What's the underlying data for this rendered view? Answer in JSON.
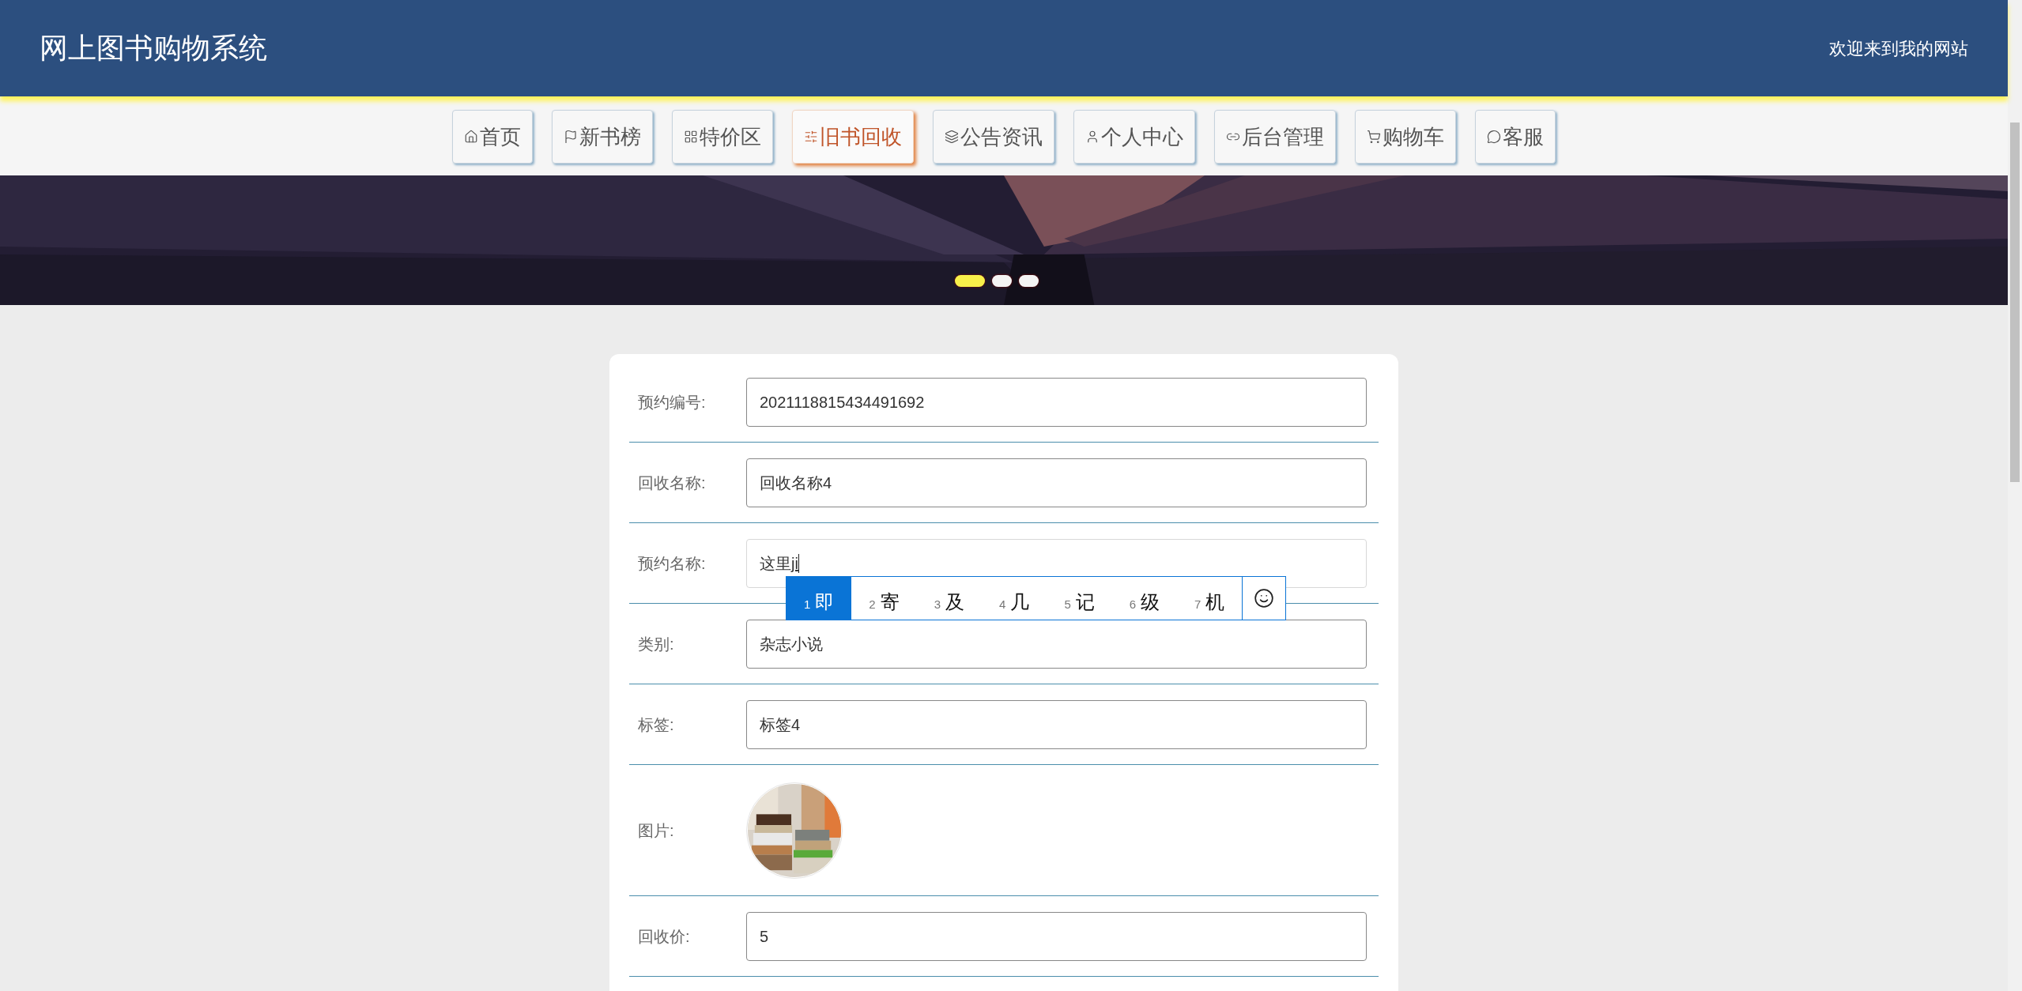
{
  "header": {
    "title": "网上图书购物系统",
    "welcome": "欢迎来到我的网站"
  },
  "nav": [
    {
      "label": "首页",
      "selected": false
    },
    {
      "label": "新书榜",
      "selected": false
    },
    {
      "label": "特价区",
      "selected": false
    },
    {
      "label": "旧书回收",
      "selected": true
    },
    {
      "label": "公告资讯",
      "selected": false
    },
    {
      "label": "个人中心",
      "selected": false
    },
    {
      "label": "后台管理",
      "selected": false
    },
    {
      "label": "购物车",
      "selected": false
    },
    {
      "label": "客服",
      "selected": false
    }
  ],
  "banner": {
    "kind": "picture",
    "dots": [
      {
        "selected": true
      },
      {
        "selected": false
      },
      {
        "selected": false
      }
    ]
  },
  "form": [
    {
      "kind": "input",
      "label": "预约编号:",
      "value": "2021118815434491692",
      "focused": false
    },
    {
      "kind": "input",
      "label": "回收名称:",
      "value": "回收名称4",
      "focused": false
    },
    {
      "kind": "input",
      "label": "预约名称:",
      "value": "这里",
      "composition": "ji",
      "focused": true
    },
    {
      "kind": "input",
      "label": "类别:",
      "value": "杂志小说",
      "focused": false
    },
    {
      "kind": "input",
      "label": "标签:",
      "value": "标签4",
      "focused": false
    },
    {
      "label": "图片:"
    },
    {
      "kind": "input",
      "label": "回收价:",
      "value": "5",
      "focused": false
    }
  ],
  "ime": {
    "candidates": [
      {
        "number": "1",
        "text": "即",
        "selected": true
      },
      {
        "number": "2",
        "text": "寄",
        "selected": false
      },
      {
        "number": "3",
        "text": "及",
        "selected": false
      },
      {
        "number": "4",
        "text": "几",
        "selected": false
      },
      {
        "number": "5",
        "text": "记",
        "selected": false
      },
      {
        "number": "6",
        "text": "级",
        "selected": false
      },
      {
        "number": "7",
        "text": "机",
        "selected": false
      }
    ]
  }
}
